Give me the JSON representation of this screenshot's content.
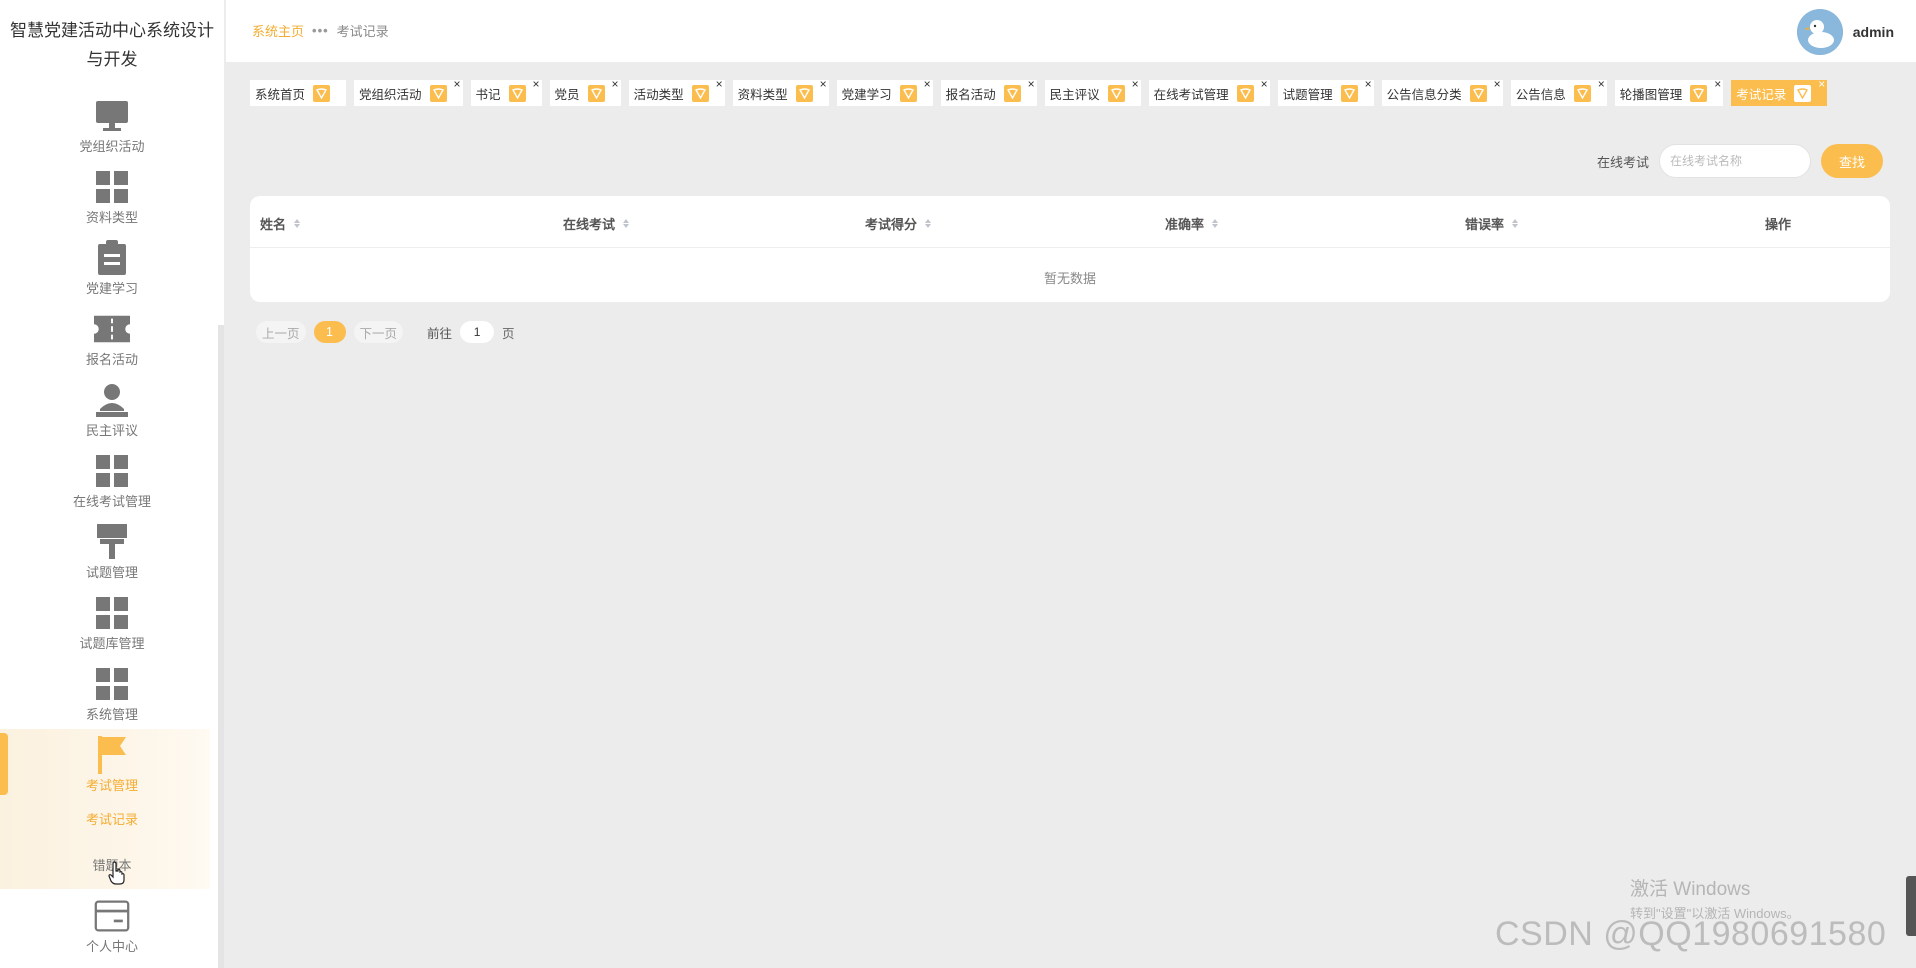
{
  "app": {
    "title": "智慧党建活动中心系统设计与开发"
  },
  "sidebar": {
    "items": [
      {
        "label": "党组织活动",
        "icon": "monitor-icon"
      },
      {
        "label": "资料类型",
        "icon": "grid-icon"
      },
      {
        "label": "党建学习",
        "icon": "clipboard-icon"
      },
      {
        "label": "报名活动",
        "icon": "ticket-icon"
      },
      {
        "label": "民主评议",
        "icon": "user-icon"
      },
      {
        "label": "在线考试管理",
        "icon": "grid-icon"
      },
      {
        "label": "试题管理",
        "icon": "brush-icon"
      },
      {
        "label": "试题库管理",
        "icon": "grid-icon"
      },
      {
        "label": "系统管理",
        "icon": "grid-icon"
      },
      {
        "label": "考试管理",
        "icon": "flag-icon"
      }
    ],
    "sub_items": [
      "考试记录",
      "错题本"
    ],
    "bottom_item": {
      "label": "个人中心",
      "icon": "card-icon"
    }
  },
  "header": {
    "breadcrumb_home": "系统主页",
    "breadcrumb_sep": "•••",
    "breadcrumb_current": "考试记录",
    "username": "admin"
  },
  "tags": [
    {
      "label": "系统首页",
      "closable": false
    },
    {
      "label": "党组织活动",
      "closable": true
    },
    {
      "label": "书记",
      "closable": true
    },
    {
      "label": "党员",
      "closable": true
    },
    {
      "label": "活动类型",
      "closable": true
    },
    {
      "label": "资料类型",
      "closable": true
    },
    {
      "label": "党建学习",
      "closable": true
    },
    {
      "label": "报名活动",
      "closable": true
    },
    {
      "label": "民主评议",
      "closable": true
    },
    {
      "label": "在线考试管理",
      "closable": true
    },
    {
      "label": "试题管理",
      "closable": true
    },
    {
      "label": "公告信息分类",
      "closable": true
    },
    {
      "label": "公告信息",
      "closable": true
    },
    {
      "label": "轮播图管理",
      "closable": true
    },
    {
      "label": "考试记录",
      "closable": true,
      "active": true
    }
  ],
  "search": {
    "label": "在线考试",
    "placeholder": "在线考试名称",
    "button": "查找"
  },
  "table": {
    "columns": [
      "姓名",
      "在线考试",
      "考试得分",
      "准确率",
      "错误率",
      "操作"
    ],
    "empty_text": "暂无数据"
  },
  "pagination": {
    "prev": "上一页",
    "page": "1",
    "next": "下一页",
    "goto_prefix": "前往",
    "goto_value": "1",
    "goto_suffix": "页"
  },
  "watermarks": {
    "win_title": "激活 Windows",
    "win_sub": "转到\"设置\"以激活 Windows。",
    "csdn": "CSDN @QQ1980691580"
  },
  "colors": {
    "accent": "#fbbd4e",
    "accent_text": "#f4ad32",
    "background": "#ececec"
  }
}
